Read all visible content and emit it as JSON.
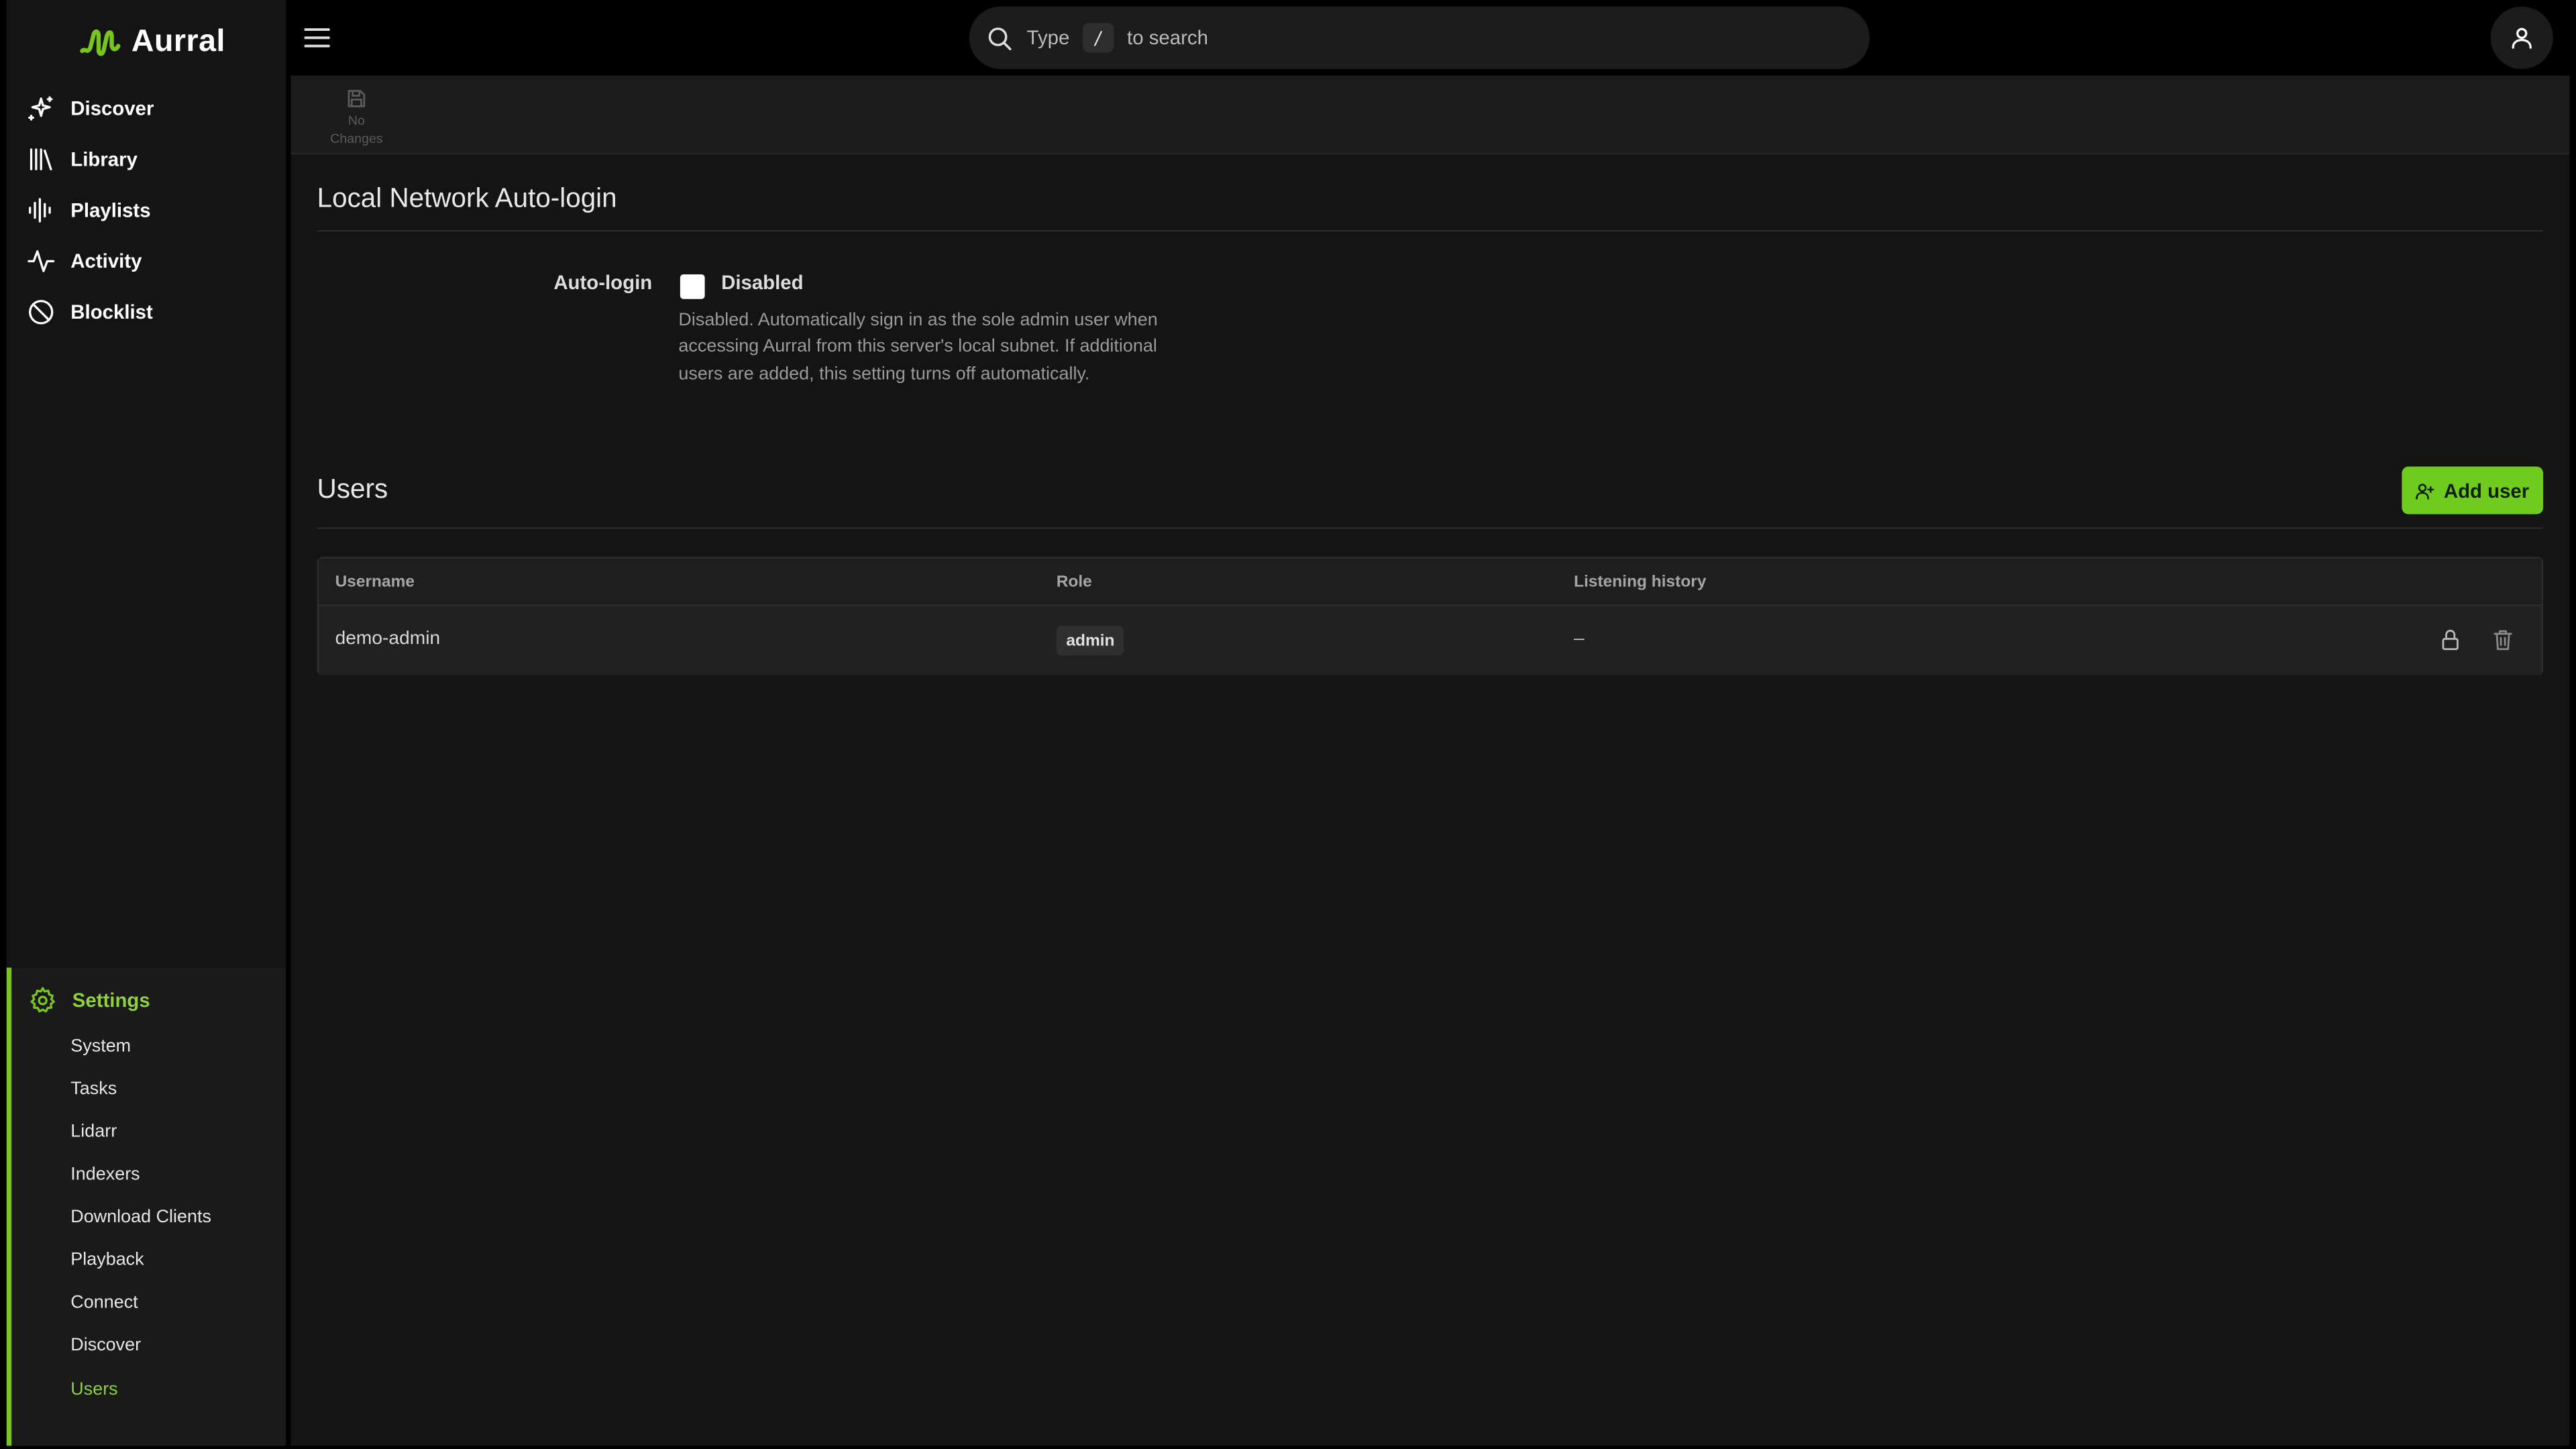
{
  "app": {
    "name": "Aurral",
    "accent_color": "#7ac41f"
  },
  "sidebar": {
    "items": [
      {
        "label": "Discover",
        "icon": "sparkles-icon"
      },
      {
        "label": "Library",
        "icon": "library-icon"
      },
      {
        "label": "Playlists",
        "icon": "waveform-icon"
      },
      {
        "label": "Activity",
        "icon": "activity-icon"
      },
      {
        "label": "Blocklist",
        "icon": "ban-icon"
      }
    ],
    "settings": {
      "label": "Settings",
      "icon": "gear-icon",
      "subitems": [
        {
          "label": "System"
        },
        {
          "label": "Tasks"
        },
        {
          "label": "Lidarr"
        },
        {
          "label": "Indexers"
        },
        {
          "label": "Download Clients"
        },
        {
          "label": "Playback"
        },
        {
          "label": "Connect"
        },
        {
          "label": "Discover"
        },
        {
          "label": "Users",
          "active": true
        }
      ]
    }
  },
  "search": {
    "prefix": "Type",
    "key": "/",
    "suffix": "to search"
  },
  "toolbar": {
    "save_line1": "No",
    "save_line2": "Changes"
  },
  "autologin_section": {
    "title": "Local Network Auto-login",
    "field_label": "Auto-login",
    "checkbox_label": "Disabled",
    "checked": false,
    "help": "Disabled. Automatically sign in as the sole admin user when accessing Aurral from this server's local subnet. If additional users are added, this setting turns off automatically."
  },
  "users_section": {
    "title": "Users",
    "add_button": "Add user",
    "columns": [
      "Username",
      "Role",
      "Listening history"
    ],
    "rows": [
      {
        "username": "demo-admin",
        "role": "admin",
        "history": "–"
      }
    ]
  }
}
